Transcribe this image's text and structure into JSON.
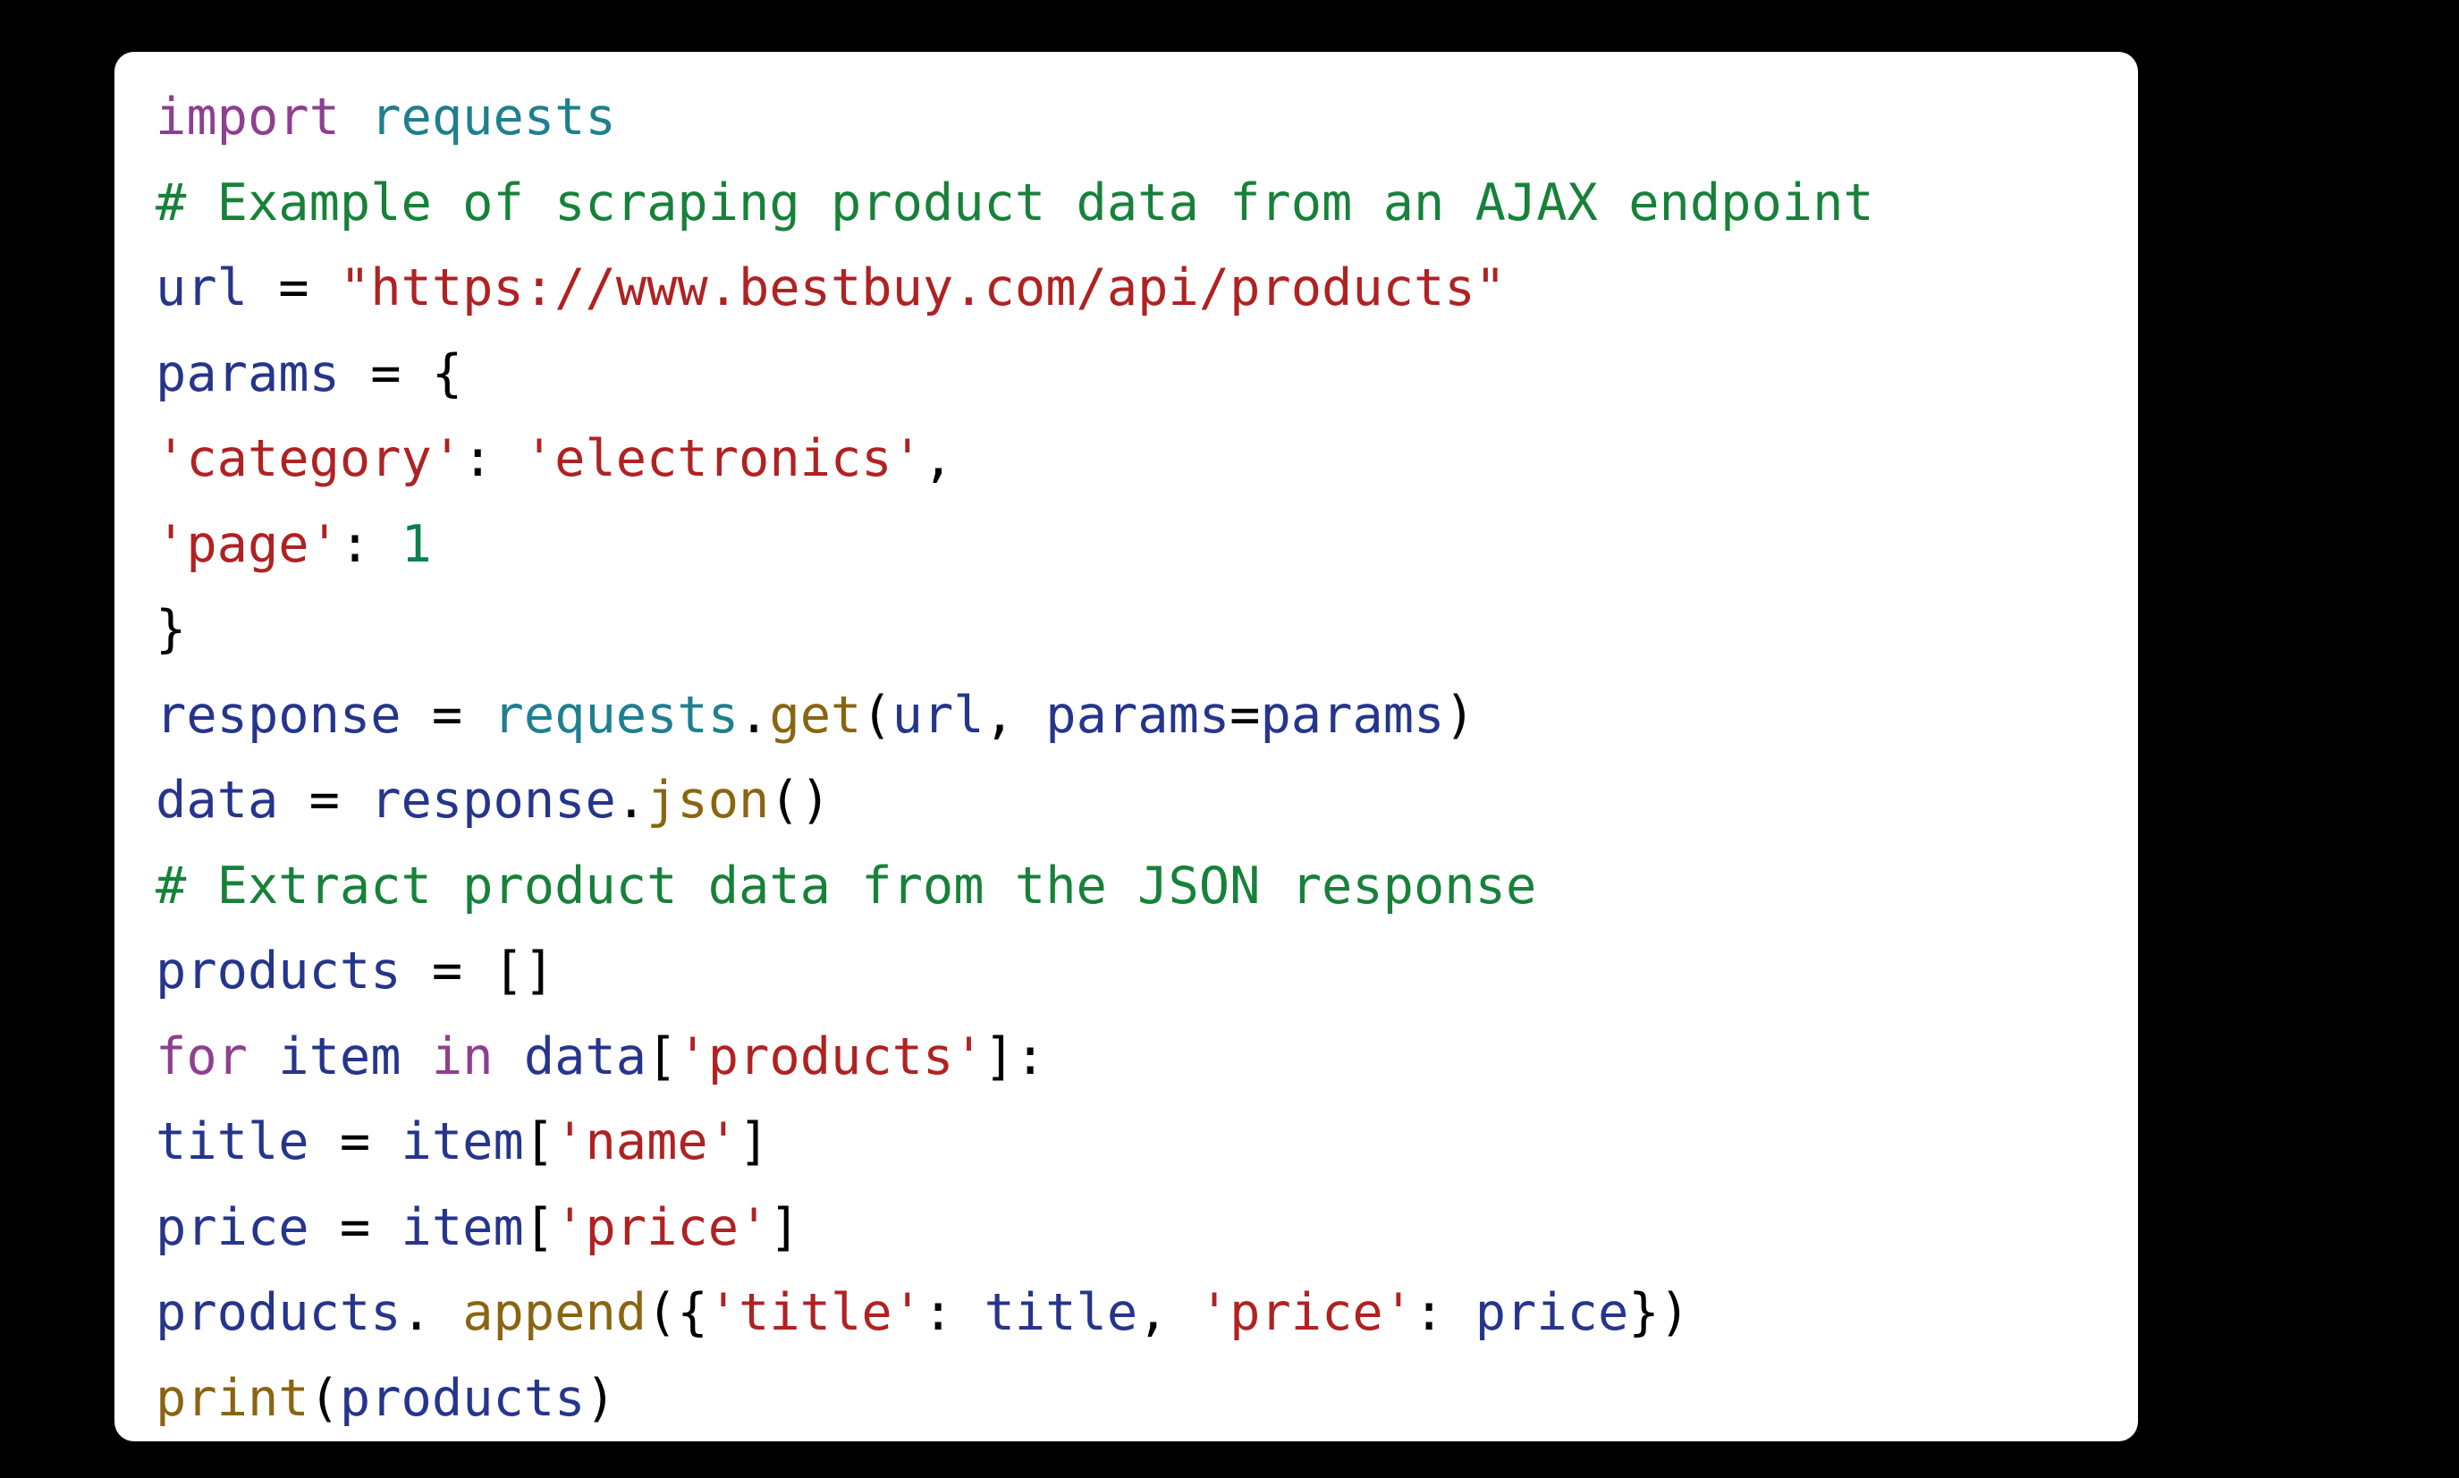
{
  "card": {
    "background_color": "#ffffff",
    "page_background_color": "#000000"
  },
  "code": {
    "language": "python",
    "colors": {
      "keyword": "#8f3f8f",
      "module": "#1f7f8f",
      "comment": "#17813a",
      "name": "#26358c",
      "operator": "#000000",
      "punctuation": "#000000",
      "string": "#b02222",
      "number": "#0c8050",
      "function": "#8a6511"
    },
    "lines": [
      "import requests",
      "# Example of scraping product data from an AJAX endpoint",
      "url = \"https://www.bestbuy.com/api/products\"",
      "params = {",
      "'category': 'electronics',",
      "'page': 1",
      "}",
      "response = requests.get(url, params=params)",
      "data = response.json()",
      "# Extract product data from the JSON response",
      "products = []",
      "for item in data['products']:",
      "title = item['name']",
      "price = item['price']",
      "products. append({'title': title, 'price': price})",
      "print(products)"
    ],
    "tokens": {
      "l1": {
        "kw_import": "import",
        "mod_requests": "requests"
      },
      "l2": {
        "comment": "# Example of scraping product data from an AJAX endpoint"
      },
      "l3": {
        "name_url": "url",
        "op_eq": " = ",
        "string_url": "\"https://www.bestbuy.com/api/products\""
      },
      "l4": {
        "name_params": "params",
        "op_eq": " = ",
        "brace_open": "{"
      },
      "l5": {
        "key_category": "'category'",
        "colon": ": ",
        "val_electronics": "'electronics'",
        "comma": ","
      },
      "l6": {
        "key_page": "'page'",
        "colon": ": ",
        "num_one": "1"
      },
      "l7": {
        "brace_close": "}"
      },
      "l8": {
        "name_response": "response",
        "op_eq": " = ",
        "mod_requests": "requests",
        "dot": ".",
        "fn_get": "get",
        "paren_open": "(",
        "arg_url": "url",
        "comma": ", ",
        "kwarg_params": "params",
        "op_eq2": "=",
        "val_params": "params",
        "paren_close": ")"
      },
      "l9": {
        "name_data": "data",
        "op_eq": " = ",
        "name_response": "response",
        "dot": ".",
        "fn_json": "json",
        "parens": "()"
      },
      "l10": {
        "comment": "# Extract product data from the JSON response"
      },
      "l11": {
        "name_products": "products",
        "op_eq": " = ",
        "brackets": "[]"
      },
      "l12": {
        "kw_for": "for",
        "name_item": "item",
        "kw_in": "in",
        "name_data": "data",
        "bracket_open": "[",
        "string_products": "'products'",
        "bracket_close": "]",
        "colon": ":"
      },
      "l13": {
        "name_title": "title",
        "op_eq": " = ",
        "name_item": "item",
        "bracket_open": "[",
        "string_name": "'name'",
        "bracket_close": "]"
      },
      "l14": {
        "name_price": "price",
        "op_eq": " = ",
        "name_item": "item",
        "bracket_open": "[",
        "string_price": "'price'",
        "bracket_close": "]"
      },
      "l15": {
        "name_products": "products",
        "dot": ". ",
        "fn_append": "append",
        "paren_brace": "({",
        "key_title": "'title'",
        "colon": ": ",
        "val_title": "title",
        "comma": ", ",
        "key_price": "'price'",
        "colon2": ": ",
        "val_price": "price",
        "close": "})"
      },
      "l16": {
        "fn_print": "print",
        "paren_open": "(",
        "arg_products": "products",
        "paren_close": ")"
      }
    }
  }
}
